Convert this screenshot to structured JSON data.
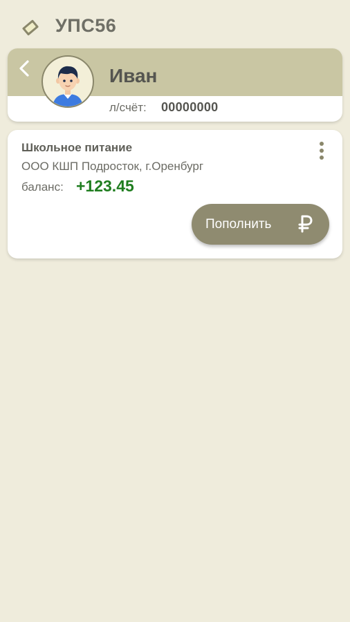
{
  "app": {
    "title": "УПС56",
    "logo_icon": "card-icon"
  },
  "profile": {
    "back_icon": "chevron-left-icon",
    "avatar_icon": "user-avatar",
    "name": "Иван",
    "account_label": "л/счёт:",
    "account_number": "00000000"
  },
  "service": {
    "title": "Школьное питание",
    "provider": "ООО КШП Подросток, г.Оренбург",
    "balance_label": "баланс:",
    "balance_value": "+123.45",
    "more_icon": "more-vertical-icon",
    "topup_label": "Пополнить",
    "currency_icon": "ruble-icon"
  },
  "colors": {
    "background": "#efecdc",
    "header": "#c9c6a3",
    "accent": "#8f8b70",
    "balance_positive": "#1f7d1f",
    "text": "#555550"
  }
}
